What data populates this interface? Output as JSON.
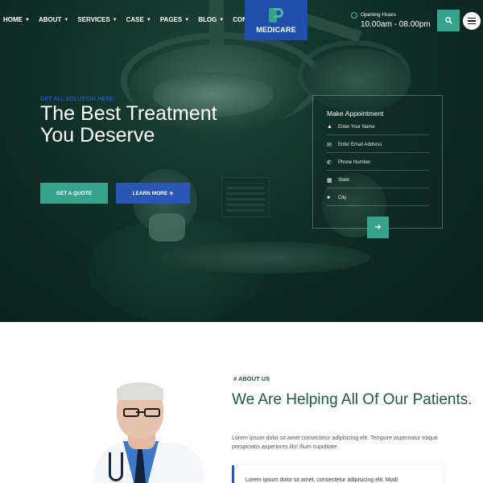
{
  "nav": {
    "items": [
      {
        "label": "HOME",
        "caret": true
      },
      {
        "label": "ABOUT",
        "caret": true
      },
      {
        "label": "SERVICES",
        "caret": true
      },
      {
        "label": "CASE",
        "caret": true
      },
      {
        "label": "PAGES",
        "caret": true
      },
      {
        "label": "BLOG",
        "caret": true
      },
      {
        "label": "CONTACT",
        "caret": false
      }
    ]
  },
  "logo": {
    "text": "MEDICARE"
  },
  "hours": {
    "label": "Opening Hours",
    "value": "10.00am - 08.00pm"
  },
  "hero": {
    "tagline": "GET ALL SOLUTION HERE",
    "headline": "The Best Treatment You Deserve",
    "quote_button": "GET A QUOTE",
    "more_button": "LEARN MORE",
    "more_button_icon": "+"
  },
  "appointment": {
    "title": "Make Appointment",
    "fields": [
      {
        "icon": "user-icon",
        "glyph": "▲",
        "placeholder": "Enter Your Name"
      },
      {
        "icon": "envelope-icon",
        "glyph": "✉",
        "placeholder": "Enter Email Address"
      },
      {
        "icon": "phone-icon",
        "glyph": "✆",
        "placeholder": "Phone Number"
      },
      {
        "icon": "map-icon",
        "glyph": "▦",
        "placeholder": "State"
      },
      {
        "icon": "location-pin-icon",
        "glyph": "●",
        "placeholder": "City"
      }
    ],
    "submit_glyph": "➜"
  },
  "about": {
    "subtitle": "# ABOUT US",
    "title": "We Are Helping All Of Our Patients.",
    "text": "Lorem ipsum dolor sit amet consectetur adipisicing elit. Tempore aspernatur eaque perspiciatis asperiores illo! Illum cupiditate",
    "quote": "Lorem ipsum dolor sit amet, consectetur adipisicing elit. Modi"
  },
  "colors": {
    "accent_green": "#36a48c",
    "brand_blue": "#2a56b4",
    "heading_green": "#1f5a48",
    "hero_dark": "#0e2a23"
  }
}
